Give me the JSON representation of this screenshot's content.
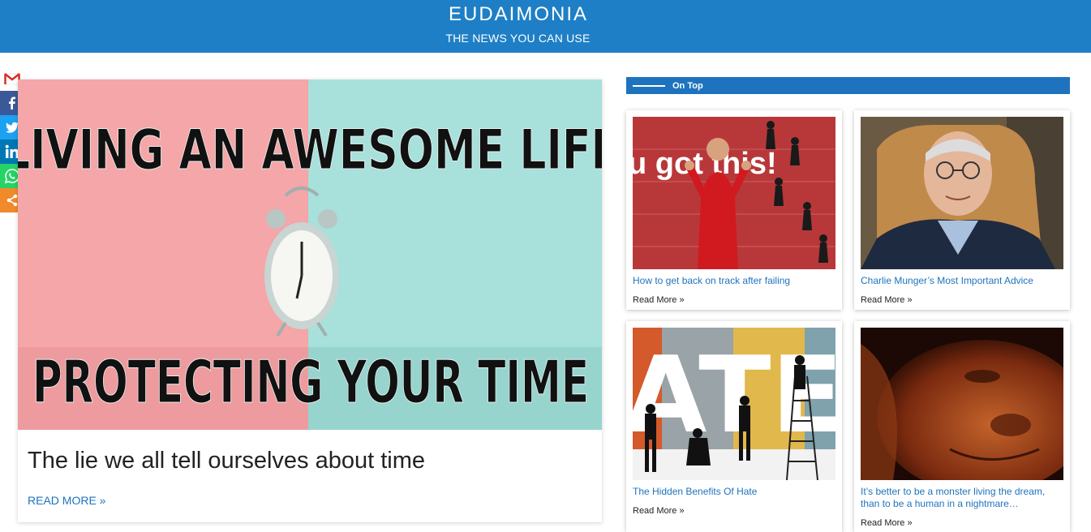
{
  "header": {
    "logo_text": "EUDAIMONIA",
    "tagline": "THE NEWS YOU CAN USE"
  },
  "share": [
    {
      "icon": "gmail-icon",
      "color": "#ffffff"
    },
    {
      "icon": "facebook-icon",
      "color": "#3b5998"
    },
    {
      "icon": "twitter-icon",
      "color": "#1da1f2"
    },
    {
      "icon": "linkedin-icon",
      "color": "#0077b5"
    },
    {
      "icon": "whatsapp-icon",
      "color": "#25d366"
    },
    {
      "icon": "share-icon",
      "color": "#f08a2b"
    }
  ],
  "feature": {
    "image_line1": "LIVING AN AWESOME LIFE",
    "image_line2": "PROTECTING YOUR TIME",
    "title": "The lie we all tell ourselves about time",
    "read_more": "READ MORE »"
  },
  "sidebar": {
    "section_title": "On Top",
    "cards": [
      {
        "title": "How to get back on track after failing",
        "read_more": "Read More »",
        "image_text": "u got this!"
      },
      {
        "title": "Charlie Munger’s Most Important Advice",
        "read_more": "Read More »"
      },
      {
        "title": "The Hidden Benefits Of Hate",
        "read_more": "Read More »",
        "image_text": "ATE"
      },
      {
        "title": "It’s better to be a monster living the dream, than to be a human in a nightmare…",
        "read_more": "Read More »"
      }
    ]
  },
  "colors": {
    "brand_blue": "#1e7fc6",
    "link_blue": "#1e73be"
  }
}
